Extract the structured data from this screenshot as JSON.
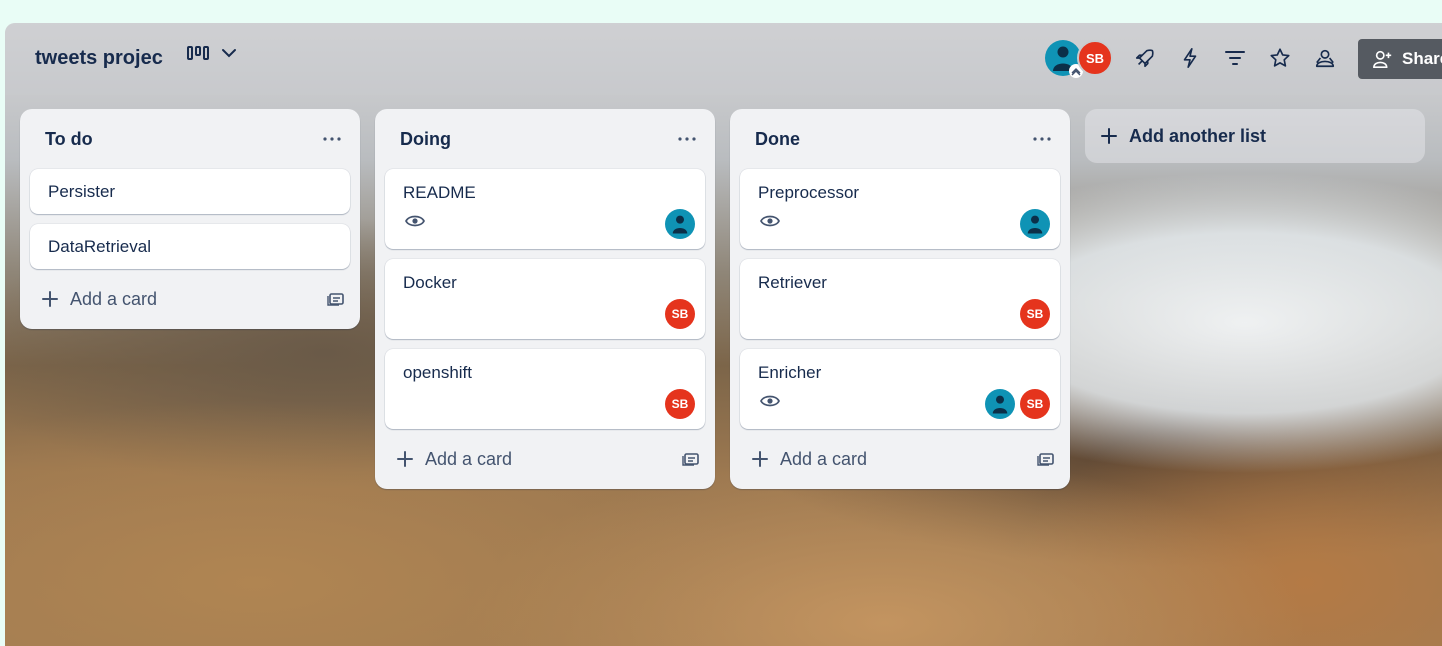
{
  "board": {
    "title": "tweets projec",
    "view_icon": "board-view-icon",
    "share_label": "Share"
  },
  "header": {
    "members": [
      {
        "type": "person",
        "icon": "person-icon"
      },
      {
        "type": "initials",
        "initials": "SB",
        "color": "#e5341d"
      }
    ],
    "actions": [
      "rocket-icon",
      "lightning-icon",
      "filter-icon",
      "star-icon",
      "workspace-visibility-icon"
    ]
  },
  "lists": [
    {
      "title": "To do",
      "cards": [
        {
          "title": "Persister"
        },
        {
          "title": "DataRetrieval"
        }
      ],
      "add_card_label": "Add a card"
    },
    {
      "title": "Doing",
      "cards": [
        {
          "title": "README",
          "watching": true,
          "members": [
            "person"
          ]
        },
        {
          "title": "Docker",
          "watching": false,
          "members": [
            "SB"
          ]
        },
        {
          "title": "openshift",
          "watching": false,
          "members": [
            "SB"
          ]
        }
      ],
      "add_card_label": "Add a card"
    },
    {
      "title": "Done",
      "cards": [
        {
          "title": "Preprocessor",
          "watching": true,
          "members": [
            "person"
          ]
        },
        {
          "title": "Retriever",
          "watching": false,
          "members": [
            "SB"
          ]
        },
        {
          "title": "Enricher",
          "watching": true,
          "members": [
            "person",
            "SB"
          ]
        }
      ],
      "add_card_label": "Add a card"
    }
  ],
  "add_list_label": "Add another list",
  "colors": {
    "accent_person": "#0f93b5",
    "accent_sb": "#e5341d",
    "list_bg": "#f1f2f4",
    "text": "#172b4d"
  }
}
